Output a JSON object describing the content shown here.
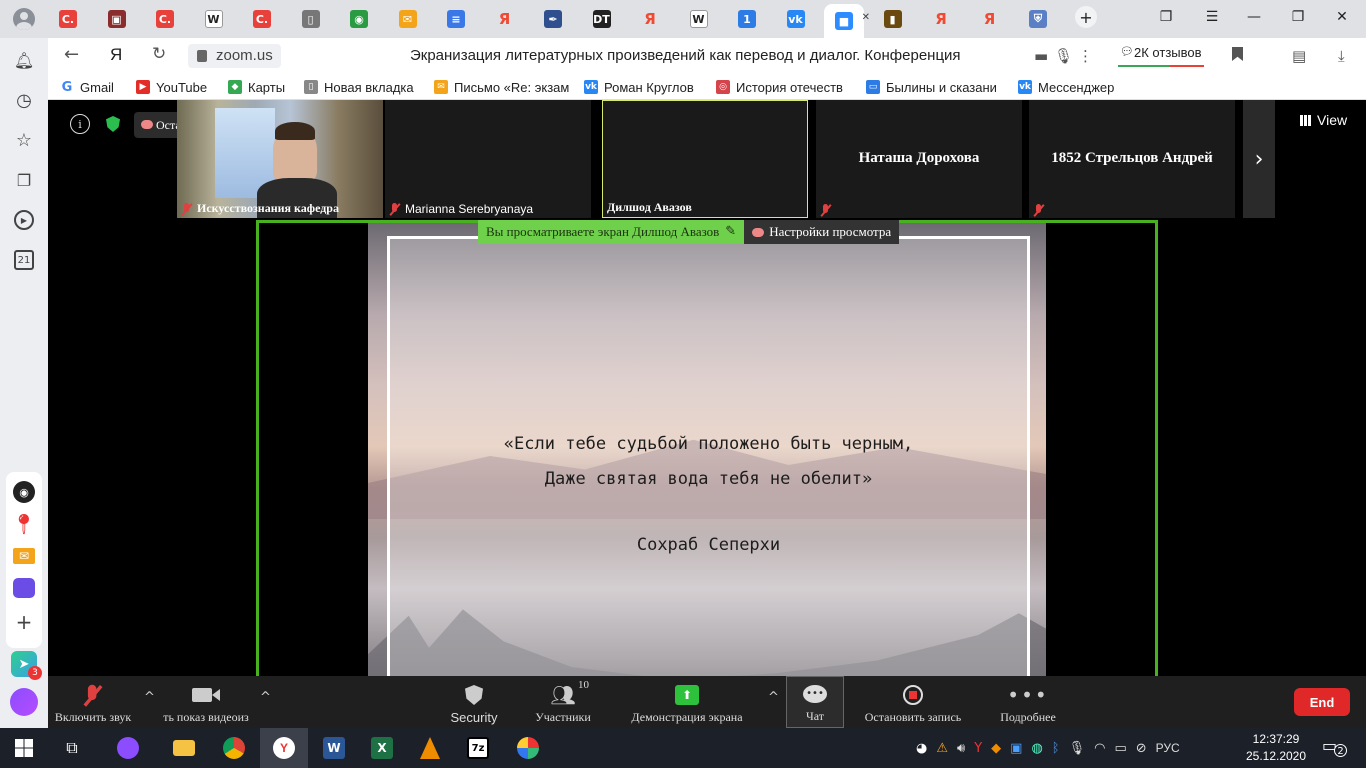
{
  "browser": {
    "tabs": [
      {
        "icon": "profile-icon"
      },
      {
        "icon": "c-red-icon",
        "glyph": "C.",
        "color": "#e8403a"
      },
      {
        "icon": "book-icon",
        "glyph": "▣",
        "color": "#8b2d2d"
      },
      {
        "icon": "c-red-icon",
        "glyph": "C.",
        "color": "#e8403a"
      },
      {
        "icon": "wikipedia-icon",
        "glyph": "W",
        "color": "#555"
      },
      {
        "icon": "c-red-icon",
        "glyph": "C.",
        "color": "#e8403a"
      },
      {
        "icon": "document-icon",
        "glyph": "▯",
        "color": "#777"
      },
      {
        "icon": "chrome-icon",
        "glyph": "◉",
        "color": "#2b9b43"
      },
      {
        "icon": "mail-icon",
        "glyph": "✉",
        "color": "#f3a41b"
      },
      {
        "icon": "docs-icon",
        "glyph": "≡",
        "color": "#3b78e7"
      },
      {
        "icon": "yandex-icon",
        "glyph": "Я",
        "color": "#f04a32"
      },
      {
        "icon": "script-icon",
        "glyph": "✒",
        "color": "#2f4f8f"
      },
      {
        "icon": "dt-icon",
        "glyph": "DT",
        "color": "#222"
      },
      {
        "icon": "yandex-icon",
        "glyph": "Я",
        "color": "#f04a32"
      },
      {
        "icon": "wikipedia-icon",
        "glyph": "W",
        "color": "#555"
      },
      {
        "icon": "number-icon",
        "glyph": "1",
        "color": "#2d7be5"
      },
      {
        "icon": "vk-icon",
        "glyph": "vk",
        "color": "#2787f5"
      },
      {
        "icon": "zoom-icon",
        "glyph": "■",
        "color": "#2d8cff"
      },
      {
        "icon": "bookmark-icon",
        "glyph": "▮",
        "color": "#6b4a10"
      },
      {
        "icon": "yandex-icon",
        "glyph": "Я",
        "color": "#f04a32"
      },
      {
        "icon": "yandex-icon",
        "glyph": "Я",
        "color": "#f04a32"
      },
      {
        "icon": "shield-icon",
        "glyph": "⛨",
        "color": "#5a7fc4"
      }
    ],
    "url": "zoom.us",
    "page_title": "Экранизация литературных произведений как перевод и диалог. Конференция",
    "reviews": "2К отзывов",
    "bookmarks": [
      {
        "icon": "google-icon",
        "glyph": "G",
        "color": "#4285f4",
        "label": "Gmail"
      },
      {
        "icon": "youtube-icon",
        "glyph": "▶",
        "color": "#e52d27",
        "label": "YouTube"
      },
      {
        "icon": "maps-icon",
        "glyph": "◆",
        "color": "#34a853",
        "label": "Карты"
      },
      {
        "icon": "page-icon",
        "glyph": "▯",
        "color": "#888",
        "label": "Новая вкладка"
      },
      {
        "icon": "mail-icon",
        "glyph": "✉",
        "color": "#f3a41b",
        "label": "Письмо «Re: экзам"
      },
      {
        "icon": "vk-icon",
        "glyph": "vk",
        "color": "#2787f5",
        "label": "Роман Круглов"
      },
      {
        "icon": "history-icon",
        "glyph": "◎",
        "color": "#d4444a",
        "label": "История отечеств"
      },
      {
        "icon": "chat-icon",
        "glyph": "▭",
        "color": "#2d7be5",
        "label": "Былины и сказани"
      },
      {
        "icon": "vk-icon",
        "glyph": "vk",
        "color": "#2787f5",
        "label": "Мессенджер"
      }
    ]
  },
  "sidebar": {
    "calendar_day": "21",
    "badge_count": "3"
  },
  "zoom": {
    "record_label": "Остановить запись",
    "view_label": "View",
    "participants": [
      {
        "name": "Искусствознания кафедра"
      },
      {
        "name": "Marianna Serebryanaya"
      },
      {
        "name": "Дилшод Авазов"
      },
      {
        "name": "Наташа Дорохова"
      },
      {
        "name": "1852 Стрельцов Андрей"
      }
    ],
    "viewing_text": "Вы просматриваете экран Дилшод Авазов",
    "view_settings": "Настройки просмотра",
    "slide": {
      "line1": "«Если тебе судьбой положено быть черным,",
      "line2": "Даже святая вода тебя не обелит»",
      "author": "Сохраб Сеперхи"
    },
    "toolbar": {
      "unmute": "Включить звук",
      "video": "ть показ видеоиз",
      "security": "Security",
      "participants": "Участники",
      "participants_count": "10",
      "share": "Демонстрация экрана",
      "chat": "Чат",
      "stop_record": "Остановить запись",
      "more": "Подробнее",
      "end": "End"
    }
  },
  "taskbar": {
    "language": "РУС",
    "time": "12:37:29",
    "date": "25.12.2020",
    "notifications": "2"
  }
}
